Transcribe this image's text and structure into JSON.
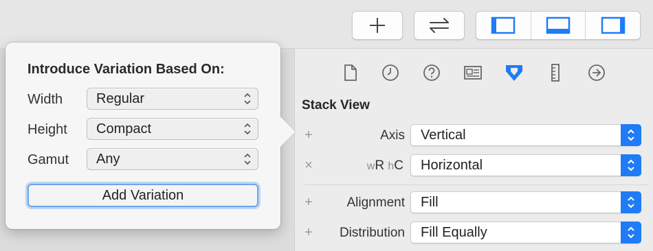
{
  "toolbar": {
    "add_icon": "plus-icon",
    "swap_icon": "arrows-left-right-icon",
    "panels": [
      "left-panel-icon",
      "bottom-panel-icon",
      "right-panel-icon"
    ],
    "accent_color": "#1f7cf6"
  },
  "popover": {
    "title": "Introduce Variation Based On:",
    "rows": [
      {
        "label": "Width",
        "value": "Regular"
      },
      {
        "label": "Height",
        "value": "Compact"
      },
      {
        "label": "Gamut",
        "value": "Any"
      }
    ],
    "add_button": "Add Variation"
  },
  "inspector": {
    "tabs": [
      "file-icon",
      "clock-icon",
      "help-icon",
      "identity-card-icon",
      "attributes-icon",
      "ruler-icon",
      "connections-arrow-icon"
    ],
    "section_title": "Stack View",
    "rows": [
      {
        "mark": "+",
        "label": "Axis",
        "value": "Vertical"
      },
      {
        "mark": "×",
        "size_w": "w",
        "size_w_val": "R",
        "size_h": "h",
        "size_h_val": "C",
        "value": "Horizontal"
      },
      {
        "mark": "+",
        "label": "Alignment",
        "value": "Fill"
      },
      {
        "mark": "+",
        "label": "Distribution",
        "value": "Fill Equally"
      }
    ]
  }
}
